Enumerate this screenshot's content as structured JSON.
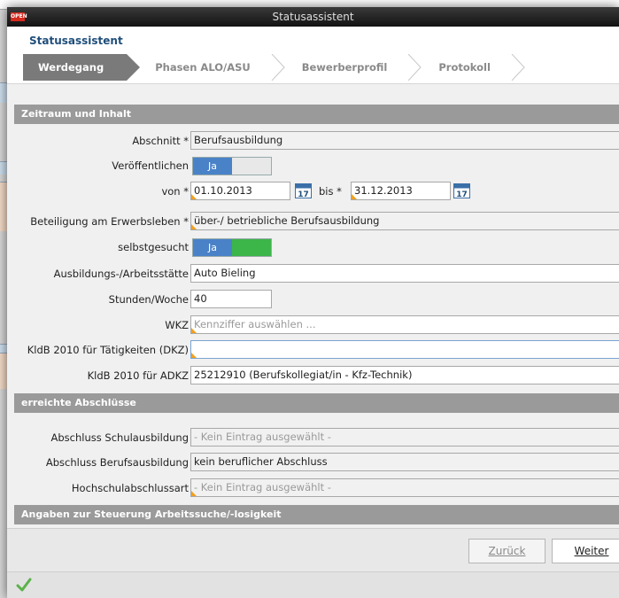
{
  "window": {
    "title": "Statusassistent",
    "logo": "OPEN"
  },
  "app": {
    "title": "Statusassistent"
  },
  "steps": [
    {
      "label": "Werdegang",
      "active": true
    },
    {
      "label": "Phasen ALO/ASU",
      "active": false
    },
    {
      "label": "Bewerberprofil",
      "active": false
    },
    {
      "label": "Protokoll",
      "active": false
    }
  ],
  "sections": {
    "zeitraum": "Zeitraum und Inhalt",
    "abschluesse": "erreichte Abschlüsse",
    "steuerung": "Angaben zur Steuerung Arbeitssuche/-losigkeit"
  },
  "form": {
    "abschnitt": {
      "label": "Abschnitt *",
      "value": "Berufsausbildung"
    },
    "veroeffentlichen": {
      "label": "Veröffentlichen",
      "value": "Ja"
    },
    "von": {
      "label": "von *",
      "value": "01.10.2013"
    },
    "bis": {
      "label": "bis *",
      "value": "31.12.2013"
    },
    "beteiligung": {
      "label": "Beteiligung am Erwerbsleben *",
      "value": "über-/ betriebliche Berufsausbildung"
    },
    "selbstgesucht": {
      "label": "selbstgesucht",
      "value": "Ja"
    },
    "arbeitsstaette": {
      "label": "Ausbildungs-/Arbeitsstätte",
      "value": "Auto Bieling"
    },
    "stunden": {
      "label": "Stunden/Woche",
      "value": "40"
    },
    "wkz": {
      "label": "WKZ",
      "placeholder": "Kennziffer auswählen ..."
    },
    "kldb_dkz": {
      "label": "KldB 2010 für Tätigkeiten (DKZ)",
      "value": ""
    },
    "kldb_adkz": {
      "label": "KldB 2010 für ADKZ",
      "value": "25212910 (Berufskollegiat/in - Kfz-Technik)"
    },
    "schulausbildung": {
      "label": "Abschluss Schulausbildung",
      "value": "- Kein Eintrag ausgewählt -"
    },
    "berufsausbildung": {
      "label": "Abschluss Berufsausbildung",
      "value": "kein beruflicher Abschluss"
    },
    "hochschul": {
      "label": "Hochschulabschlussart",
      "value": "- Kein Eintrag ausgewählt -"
    }
  },
  "calendar_icon_text": "17",
  "buttons": {
    "back": "Zurück",
    "next": "Weiter"
  },
  "colors": {
    "toggle_on": "#4a82c8",
    "toggle_green": "#3cb549",
    "section": "#9a9a9a",
    "required_mark": "#f0a020"
  },
  "status_icon": "checkmark-icon"
}
